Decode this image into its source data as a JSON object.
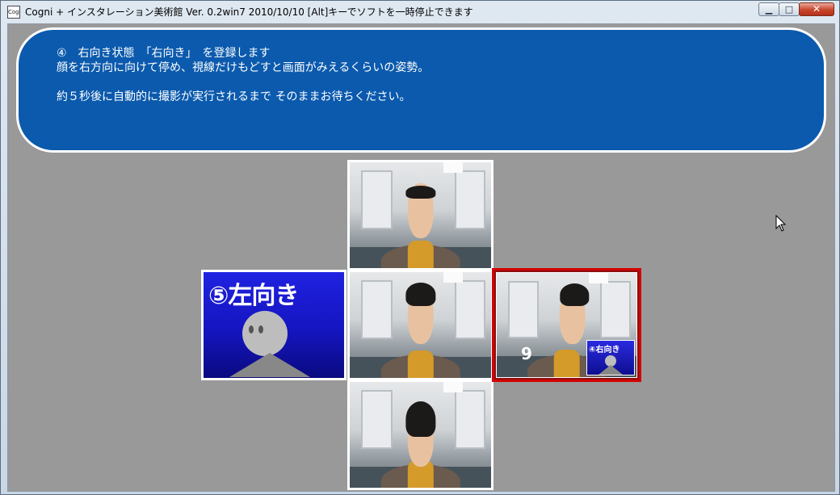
{
  "window": {
    "title": "Cogni + インスタレーション美術館 Ver. 0.2win7 2010/10/10 [Alt]キーでソフトを一時停止できます",
    "app_icon_text": "Cogi",
    "min_glyph": "▁",
    "max_glyph": "□",
    "close_glyph": "✕"
  },
  "message": {
    "line1": "④　右向き状態　「右向き」　を登録します",
    "line2": "顔を右方向に向けて停め、視線だけもどすと画面がみえるくらいの姿勢。",
    "line3": "約５秒後に自動的に撮影が実行されるまで そのままお待ちください。"
  },
  "tiles": {
    "top": {
      "pose": "up"
    },
    "center": {
      "pose": "front"
    },
    "bottom": {
      "pose": "down"
    },
    "right": {
      "pose": "right",
      "countdown": "9",
      "mini_label": "④右向き"
    },
    "left": {
      "label": "⑤左向き"
    }
  },
  "colors": {
    "accent_blue": "#0b5aad",
    "selected_red": "#d40000",
    "pose_card_blue": "#1515c0",
    "background": "#999999"
  }
}
